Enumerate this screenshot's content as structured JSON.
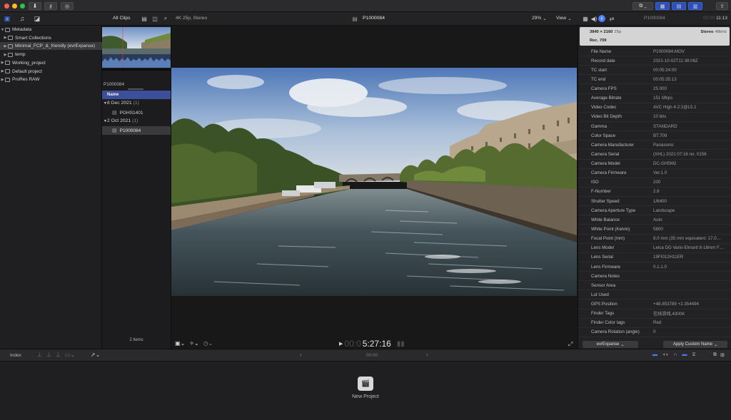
{
  "titlebar": {
    "colors": {
      "close": "#ff5f57",
      "minimize": "#febc2e",
      "zoom": "#28c840"
    }
  },
  "library": {
    "items": [
      {
        "label": "Metadata",
        "level": 0,
        "expanded": true,
        "selected": false
      },
      {
        "label": "Smart Collections",
        "level": 1,
        "expanded": false,
        "selected": false
      },
      {
        "label": "Minimal_FCP_&_friendly (evrExpanse)",
        "level": 1,
        "expanded": false,
        "selected": true
      },
      {
        "label": "temp",
        "level": 1,
        "expanded": false,
        "selected": false
      },
      {
        "label": "Working_project",
        "level": 0,
        "expanded": false,
        "selected": false
      },
      {
        "label": "Default project",
        "level": 0,
        "expanded": false,
        "selected": false
      },
      {
        "label": "ProRes RAW",
        "level": 0,
        "expanded": false,
        "selected": false
      }
    ]
  },
  "browser": {
    "filter_label": "All Clips",
    "clip_name": "P1000084",
    "column_header": "Name",
    "groups": [
      {
        "date": "8 Dec 2021",
        "count": "(1)",
        "clips": [
          "PGHS1401"
        ]
      },
      {
        "date": "2 Oct 2021",
        "count": "(1)",
        "clips": [
          "P1000084"
        ]
      }
    ],
    "footer": "2 items"
  },
  "viewer": {
    "format": "4K 25p, Stereo",
    "title": "P1000084",
    "zoom": "29%",
    "view_label": "View",
    "timecode_dim": "00:0",
    "timecode": "5:27:16"
  },
  "inspector": {
    "title": "P1000084",
    "duration_dim": "00:00:",
    "duration": "11:13",
    "resolution": "3840 × 2160",
    "rate": "25p",
    "audio": "Stereo",
    "audio_rate": "48kHz",
    "colorspace": "Rec. 709",
    "rows": [
      {
        "k": "File Name",
        "v": "P1000084.MOV"
      },
      {
        "k": "Record date",
        "v": "2021-10-02T11:38:06Z"
      },
      {
        "k": "TC start",
        "v": "00:05:24:00"
      },
      {
        "k": "TC end",
        "v": "00:05:35:13"
      },
      {
        "k": "Camera FPS",
        "v": "25.000"
      },
      {
        "k": "Average Bitrate",
        "v": "151 Mbps"
      },
      {
        "k": "Video Codec",
        "v": "AVC High 4:2:2@L5.1"
      },
      {
        "k": "Video Bit Depth",
        "v": "10 bits"
      },
      {
        "k": "Gamma",
        "v": "STANDARD"
      },
      {
        "k": "Color Space",
        "v": "BT.709"
      },
      {
        "k": "Camera Manufacturer",
        "v": "Panasonic"
      },
      {
        "k": "Camera Serial",
        "v": "(XHL) 2021:07:16 no. 0156"
      },
      {
        "k": "Camera Model",
        "v": "DC-GH5M2"
      },
      {
        "k": "Camera Firmware",
        "v": "Ver.1.0"
      },
      {
        "k": "ISO",
        "v": "200"
      },
      {
        "k": "F-Number",
        "v": "2.8"
      },
      {
        "k": "Shutter Speed",
        "v": "1/6400"
      },
      {
        "k": "Camera Aperture Type",
        "v": "Landscape"
      },
      {
        "k": "White Balance",
        "v": "Auto"
      },
      {
        "k": "White Point (Kelvin)",
        "v": "5800"
      },
      {
        "k": "Focal Point (mm)",
        "v": "8.0 mm (35 mm equivalent: 17.0…"
      },
      {
        "k": "Lens Model",
        "v": "Leica DG Vario-Elmarit 8-18mm F…"
      },
      {
        "k": "Lens Serial",
        "v": "19FI012H11ER"
      },
      {
        "k": "Lens Firmware",
        "v": "0.1.1.0"
      },
      {
        "k": "Camera Notes",
        "v": ""
      },
      {
        "k": "Sensor Area",
        "v": ""
      },
      {
        "k": "Lut Used",
        "v": ""
      },
      {
        "k": "GPS Position",
        "v": "+48.853789 +2.354494"
      },
      {
        "k": "Finder Tags",
        "v": "在线游戏,4300K"
      },
      {
        "k": "Finder Color tags",
        "v": "Red"
      },
      {
        "k": "Camera Rotation (angle)",
        "v": "0"
      }
    ],
    "metadata_view": "evrExpanse",
    "apply_button": "Apply Custom Name"
  },
  "timeline": {
    "index_label": "Index",
    "timecode": "00:00",
    "new_project": "New Project"
  }
}
